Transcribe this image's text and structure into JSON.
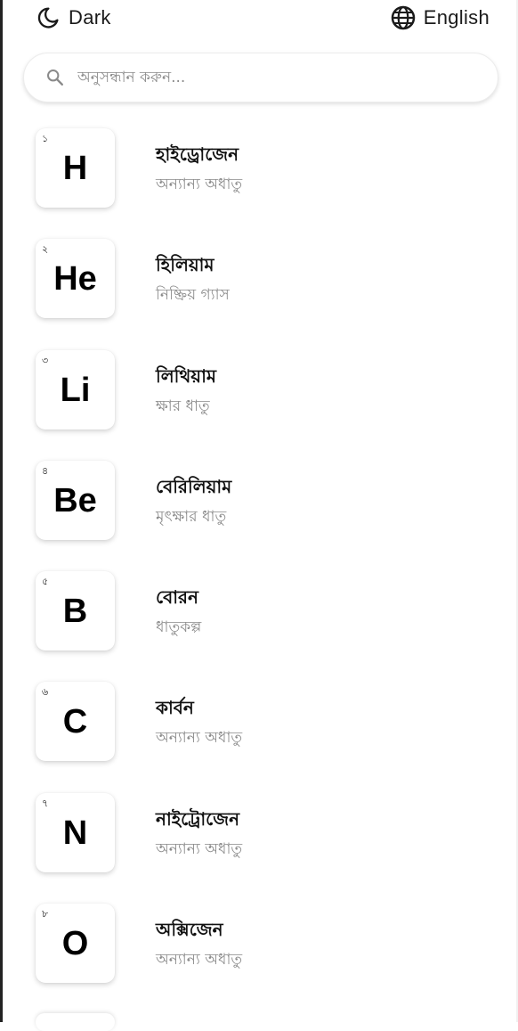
{
  "header": {
    "theme_label": "Dark",
    "theme_icon": "moon-icon",
    "language_label": "English",
    "language_icon": "globe-icon"
  },
  "search": {
    "placeholder": "অনুসন্ধান করুন...",
    "value": "",
    "icon": "search-icon"
  },
  "elements": [
    {
      "number": "১",
      "symbol": "H",
      "name": "হাইড্রোজেন",
      "category": "অন্যান্য অধাতু"
    },
    {
      "number": "২",
      "symbol": "He",
      "name": "হিলিয়াম",
      "category": "নিষ্ক্রিয় গ্যাস"
    },
    {
      "number": "৩",
      "symbol": "Li",
      "name": "লিথিয়াম",
      "category": "ক্ষার ধাতু"
    },
    {
      "number": "৪",
      "symbol": "Be",
      "name": "বেরিলিয়াম",
      "category": "মৃৎক্ষার ধাতু"
    },
    {
      "number": "৫",
      "symbol": "B",
      "name": "বোরন",
      "category": "ধাতুকল্প"
    },
    {
      "number": "৬",
      "symbol": "C",
      "name": "কার্বন",
      "category": "অন্যান্য অধাতু"
    },
    {
      "number": "৭",
      "symbol": "N",
      "name": "নাইট্রোজেন",
      "category": "অন্যান্য অধাতু"
    },
    {
      "number": "৮",
      "symbol": "O",
      "name": "অক্সিজেন",
      "category": "অন্যান্য অধাতু"
    }
  ],
  "colors": {
    "text_primary": "#111111",
    "text_secondary": "#8a8a8a",
    "background": "#ffffff"
  }
}
